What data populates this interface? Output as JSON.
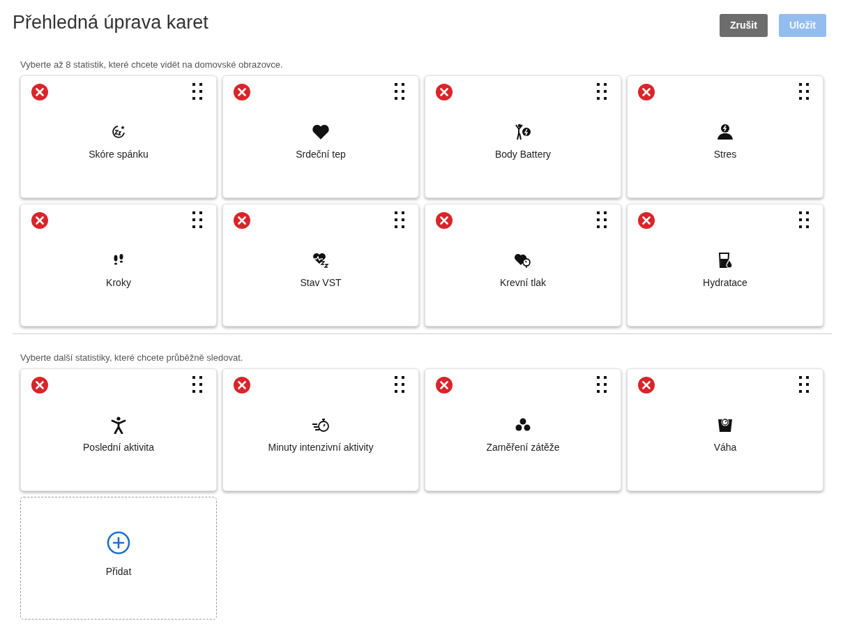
{
  "title": "Přehledná úprava karet",
  "buttons": [
    {
      "label": "Zrušit",
      "kind": "secondary",
      "disabled": false
    },
    {
      "label": "Uložit",
      "kind": "primary",
      "disabled": true
    }
  ],
  "sections": [
    {
      "hint": "Vyberte až 8 statistik, které chcete vidět na domovské obrazovce.",
      "cards": [
        {
          "label": "Skóre spánku",
          "kind": "sleep"
        },
        {
          "label": "Srdeční tep",
          "kind": "heart"
        },
        {
          "label": "Body Battery",
          "kind": "battery"
        },
        {
          "label": "Stres",
          "kind": "stress"
        },
        {
          "label": "Kroky",
          "kind": "steps"
        },
        {
          "label": "Stav VST",
          "kind": "hrv"
        },
        {
          "label": "Krevní tlak",
          "kind": "pressure"
        },
        {
          "label": "Hydratace",
          "kind": "hydration"
        }
      ]
    },
    {
      "hint": "Vyberte další statistiky, které chcete průběžně sledovat.",
      "cards": [
        {
          "label": "Poslední aktivita",
          "kind": "activity"
        },
        {
          "label": "Minuty intenzivní aktivity",
          "kind": "minutes"
        },
        {
          "label": "Zaměření zátěže",
          "kind": "load"
        },
        {
          "label": "Váha",
          "kind": "weight"
        }
      ],
      "add_card": {
        "label": "Přidat"
      }
    }
  ]
}
